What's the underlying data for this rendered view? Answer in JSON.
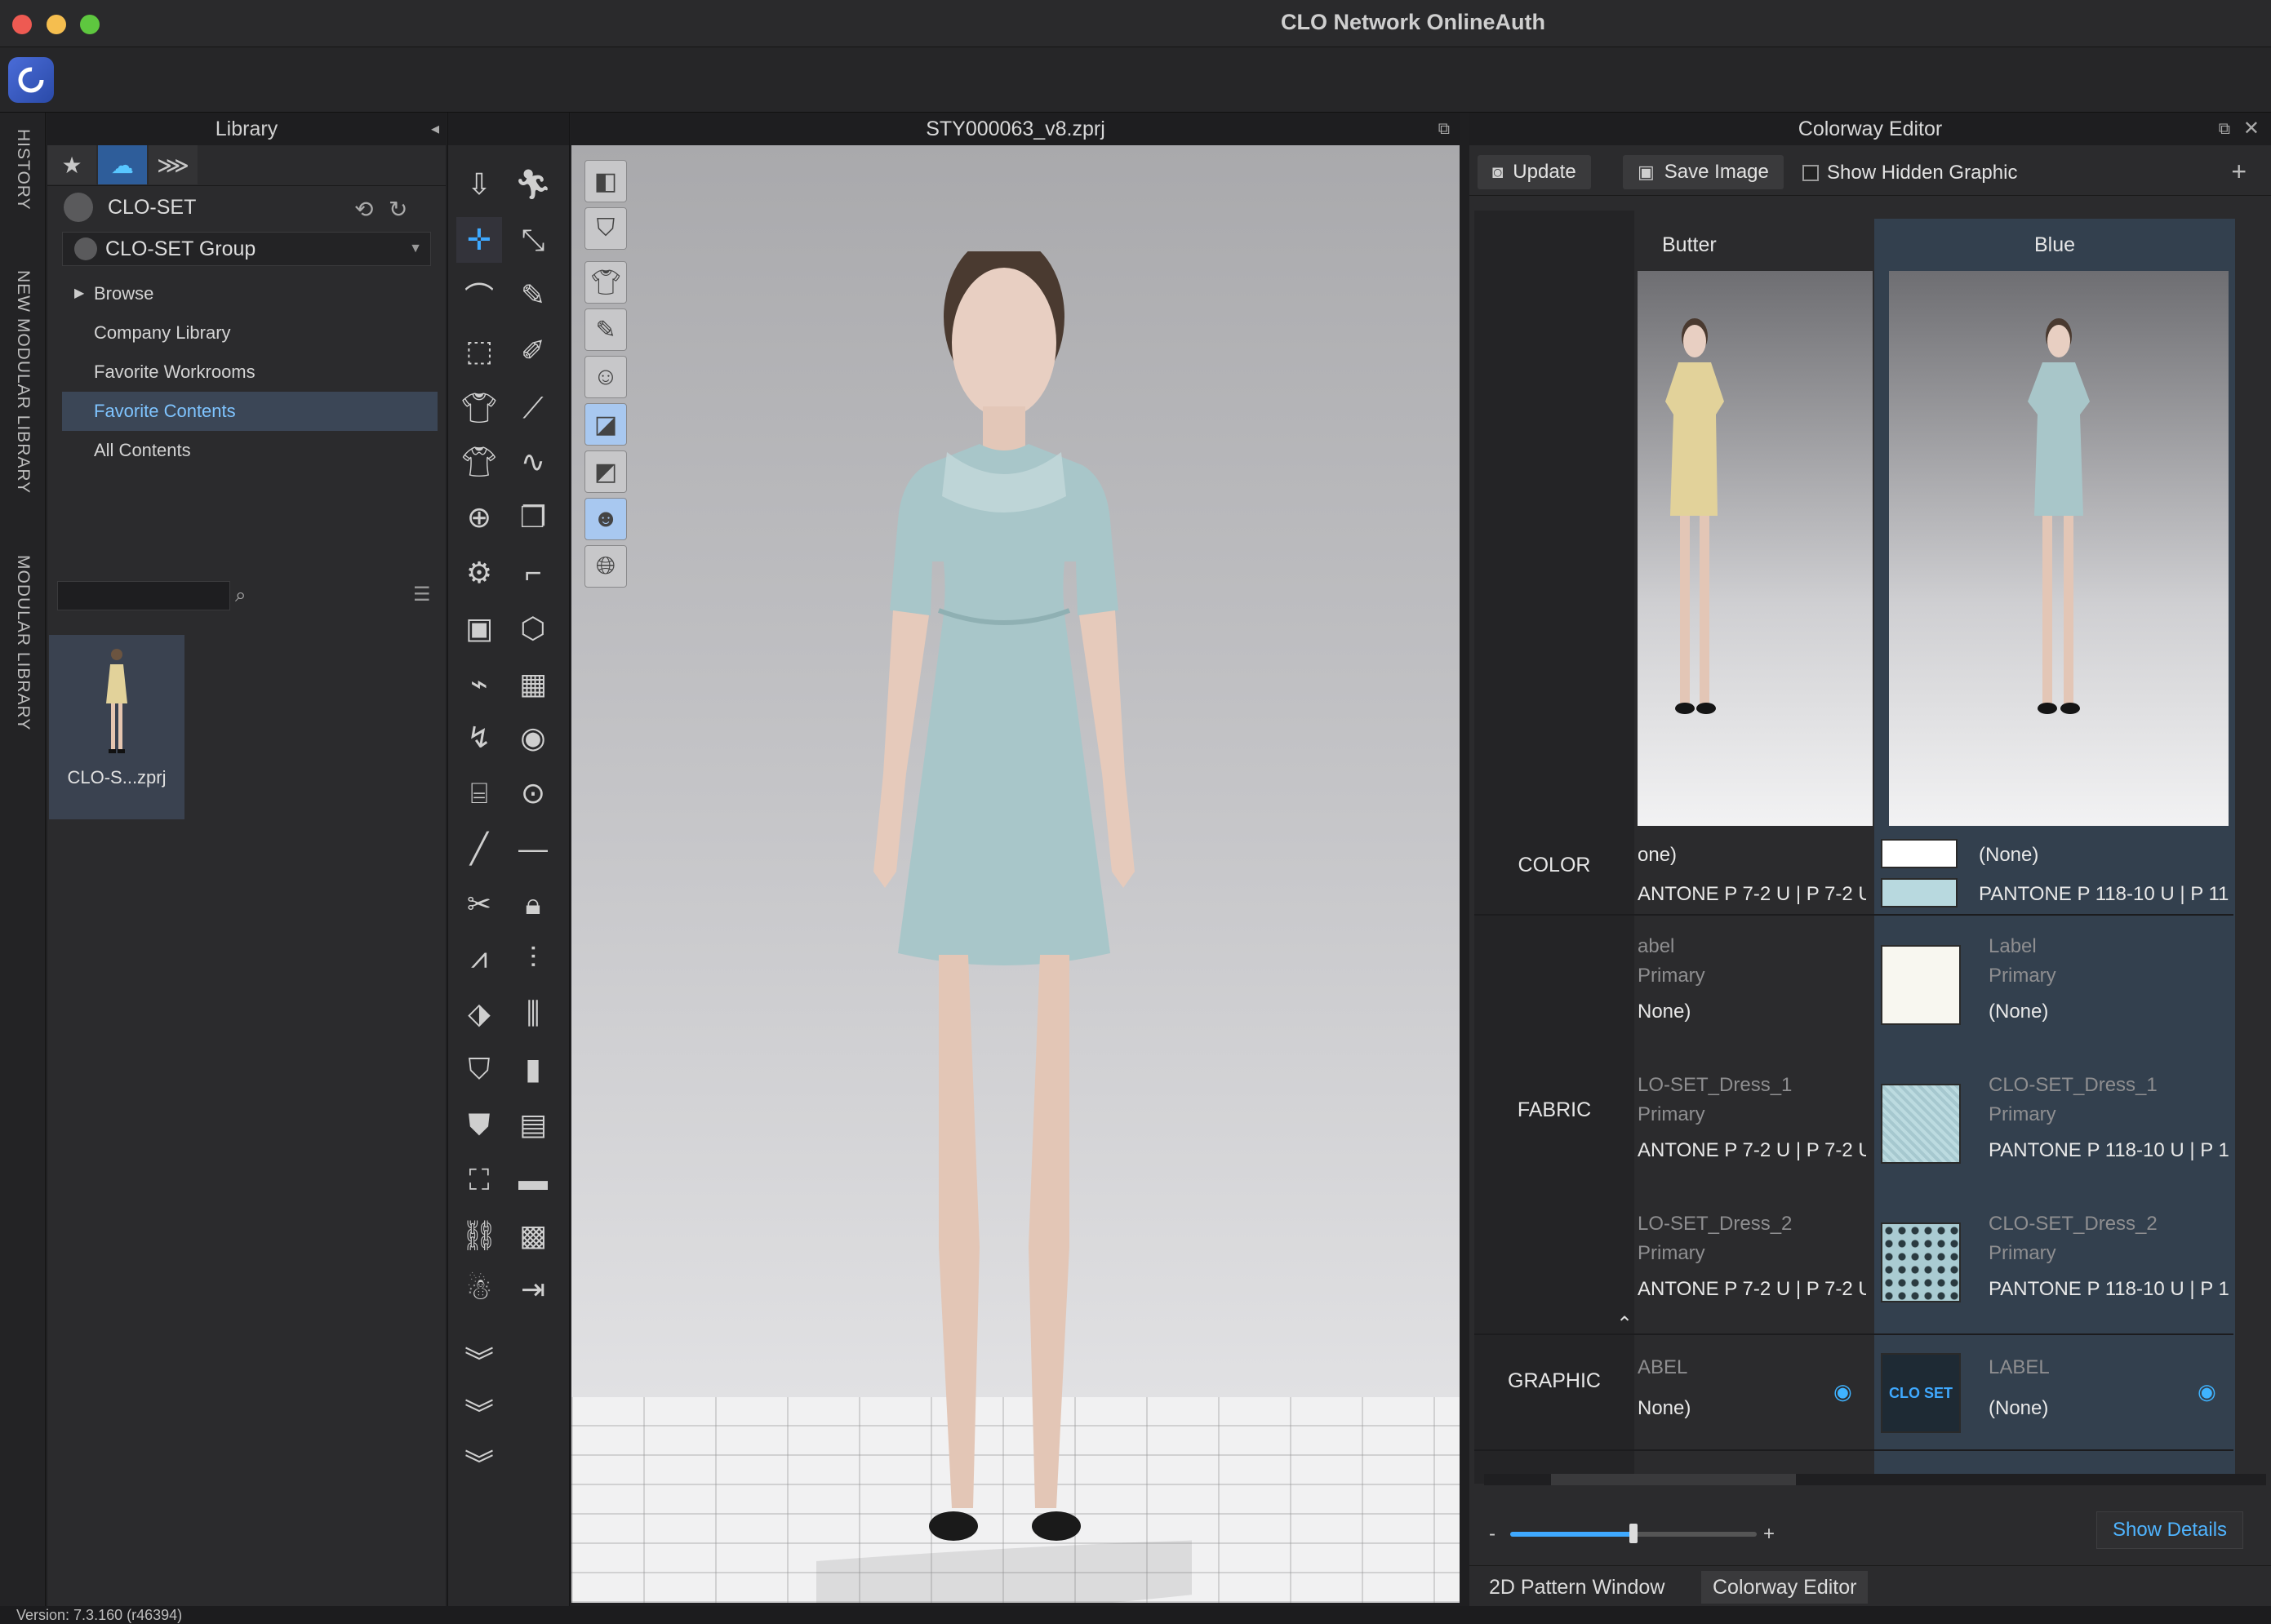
{
  "window": {
    "title": "CLO Network OnlineAuth"
  },
  "side_tabs": [
    "HISTORY",
    "NEW MODULAR LIBRARY",
    "MODULAR LIBRARY"
  ],
  "library": {
    "title": "Library",
    "user": "CLO-SET",
    "group": "CLO-SET Group",
    "tree": [
      "Browse",
      "Company Library",
      "Favorite Workrooms",
      "Favorite Contents",
      "All Contents"
    ],
    "selected": "Favorite Contents",
    "search_placeholder": "",
    "thumbnail_caption": "CLO-S...zprj"
  },
  "viewport": {
    "title": "STY000063_v8.zprj"
  },
  "colorway": {
    "title": "Colorway Editor",
    "update_label": "Update",
    "save_image_label": "Save Image",
    "show_hidden_label": "Show Hidden Graphic",
    "columns": [
      {
        "name": "Butter",
        "color": [
          "one)",
          "ANTONE P 7-2 U | P 7-2 U"
        ],
        "fabric": [
          {
            "label": "abel",
            "primary": "Primary",
            "value": "None)"
          },
          {
            "label": "LO-SET_Dress_1",
            "primary": "Primary",
            "value": "ANTONE P 7-2 U | P 7-2 U"
          },
          {
            "label": "LO-SET_Dress_2",
            "primary": "Primary",
            "value": "ANTONE P 7-2 U | P 7-2 U"
          }
        ],
        "graphic": {
          "label": "ABEL",
          "value": "None)"
        },
        "dress_color": "#e2d29a"
      },
      {
        "name": "Blue",
        "color": [
          "(None)",
          "PANTONE P 118-10 U | P 11"
        ],
        "fabric": [
          {
            "label": "Label",
            "primary": "Primary",
            "value": "(None)"
          },
          {
            "label": "CLO-SET_Dress_1",
            "primary": "Primary",
            "value": "PANTONE P 118-10 U | P 1"
          },
          {
            "label": "CLO-SET_Dress_2",
            "primary": "Primary",
            "value": "PANTONE P 118-10 U | P 1"
          }
        ],
        "graphic": {
          "label": "LABEL",
          "value": "(None)"
        },
        "dress_color": "#a8c6c9",
        "swatch_color": "#b8d9df"
      }
    ],
    "row_labels": {
      "color": "COLOR",
      "fabric": "FABRIC",
      "graphic": "GRAPHIC"
    },
    "graphic_logo_text": "CLO SET",
    "show_details_label": "Show Details",
    "zoom_minus": "-",
    "zoom_plus": "+",
    "zoom_level": 0.5,
    "bottom_tabs": [
      "2D Pattern Window",
      "Colorway Editor"
    ]
  },
  "status": {
    "version": "Version: 7.3.160 (r46394)"
  },
  "colors": {
    "accent": "#3fa9ff",
    "selected_bg": "#3b4656",
    "dress_blue": "#a8c6c9",
    "dress_butter": "#e2d29a"
  }
}
